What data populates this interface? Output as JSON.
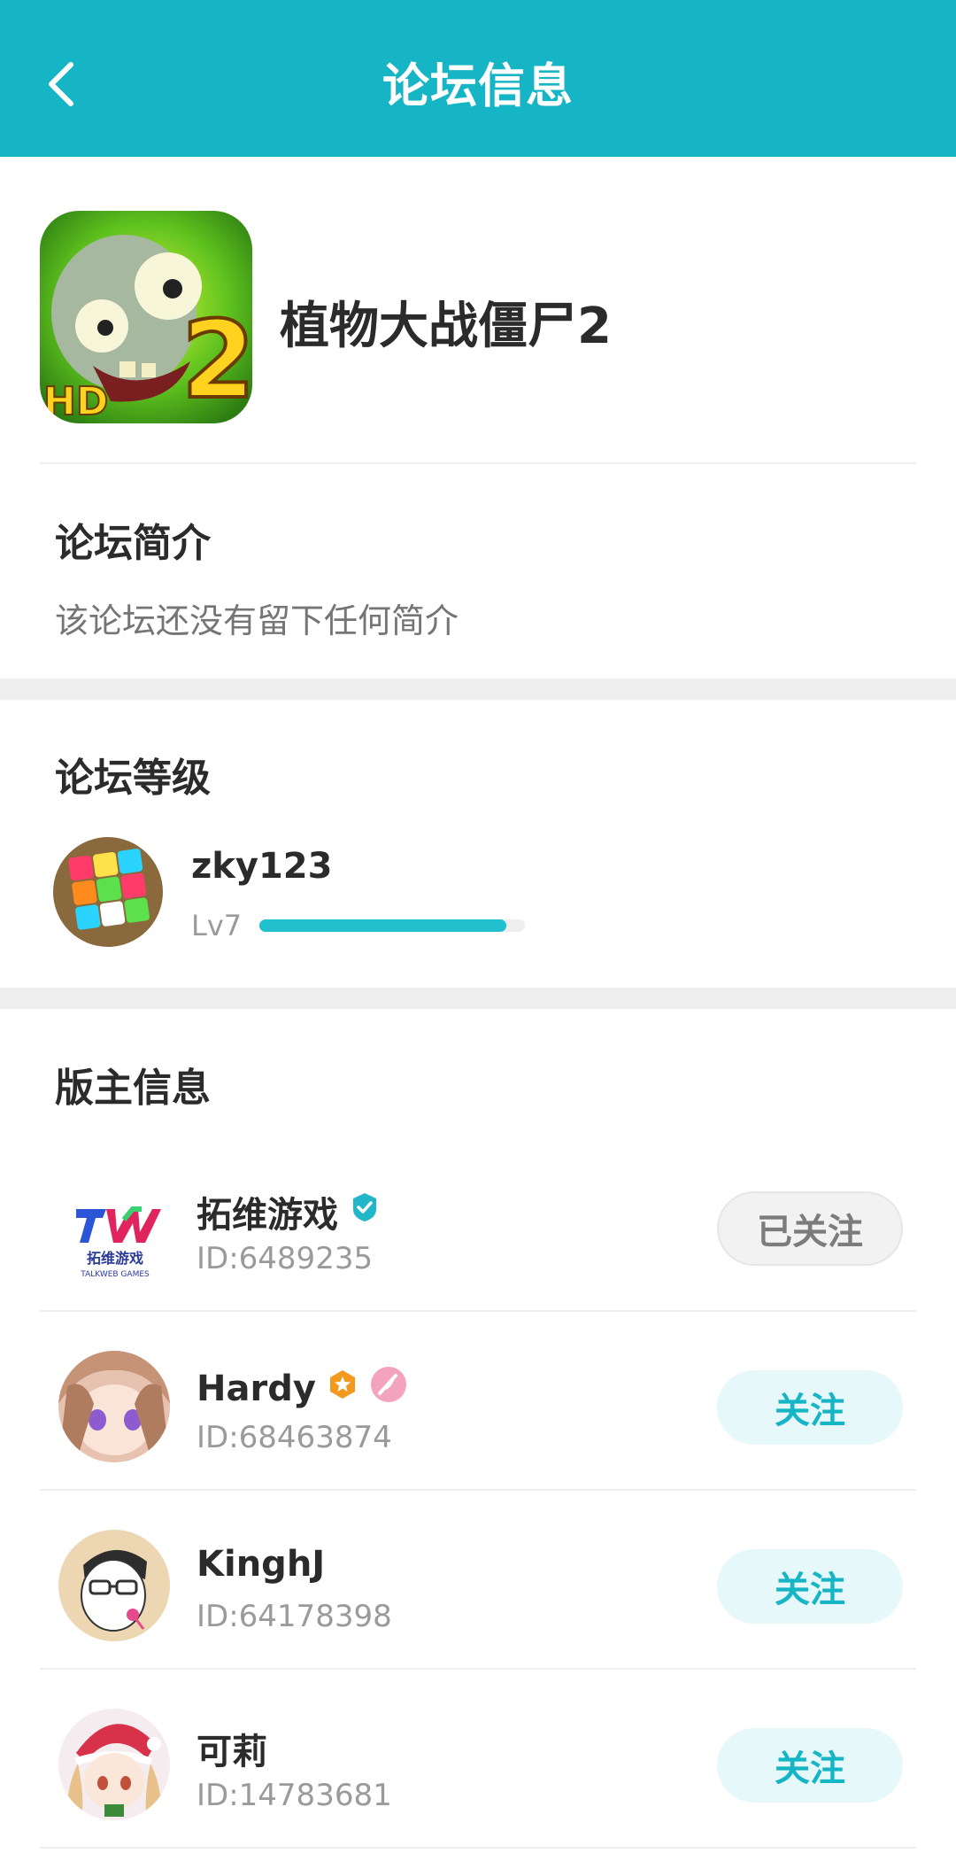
{
  "header": {
    "title": "论坛信息",
    "back_icon": "chevron-left-icon"
  },
  "forum": {
    "name": "植物大战僵尸2",
    "icon": "pvz2-hd-game-icon"
  },
  "intro": {
    "title": "论坛简介",
    "text": "该论坛还没有留下任何简介"
  },
  "level": {
    "title": "论坛等级",
    "user": {
      "name": "zky123",
      "level_label": "Lv7",
      "progress": 0.93,
      "avatar": "rubiks-cube-avatar"
    }
  },
  "moderators": {
    "title": "版主信息",
    "list": [
      {
        "name": "拓维游戏",
        "id_label": "ID:6489235",
        "button": "已关注",
        "following": true,
        "badges": [
          "verified-check-icon"
        ],
        "avatar": "talkweb-logo"
      },
      {
        "name": "Hardy",
        "id_label": "ID:68463874",
        "button": "关注",
        "following": false,
        "badges": [
          "orange-star-badge-icon",
          "pink-feather-badge-icon"
        ],
        "avatar": "anime-girl-avatar"
      },
      {
        "name": "KinghJ",
        "id_label": "ID:64178398",
        "button": "关注",
        "following": false,
        "badges": [],
        "avatar": "cartoon-glasses-avatar"
      },
      {
        "name": "可莉",
        "id_label": "ID:14783681",
        "button": "关注",
        "following": false,
        "badges": [],
        "avatar": "santa-anime-avatar"
      }
    ]
  },
  "colors": {
    "accent": "#16b5c5",
    "follow_bg": "#e7f8fa",
    "following_bg": "#f2f2f2"
  },
  "logo_text": {
    "talkweb_cn": "拓维游戏",
    "talkweb_en": "TALKWEB GAMES",
    "game_hd": "HD",
    "game_num": "2"
  }
}
